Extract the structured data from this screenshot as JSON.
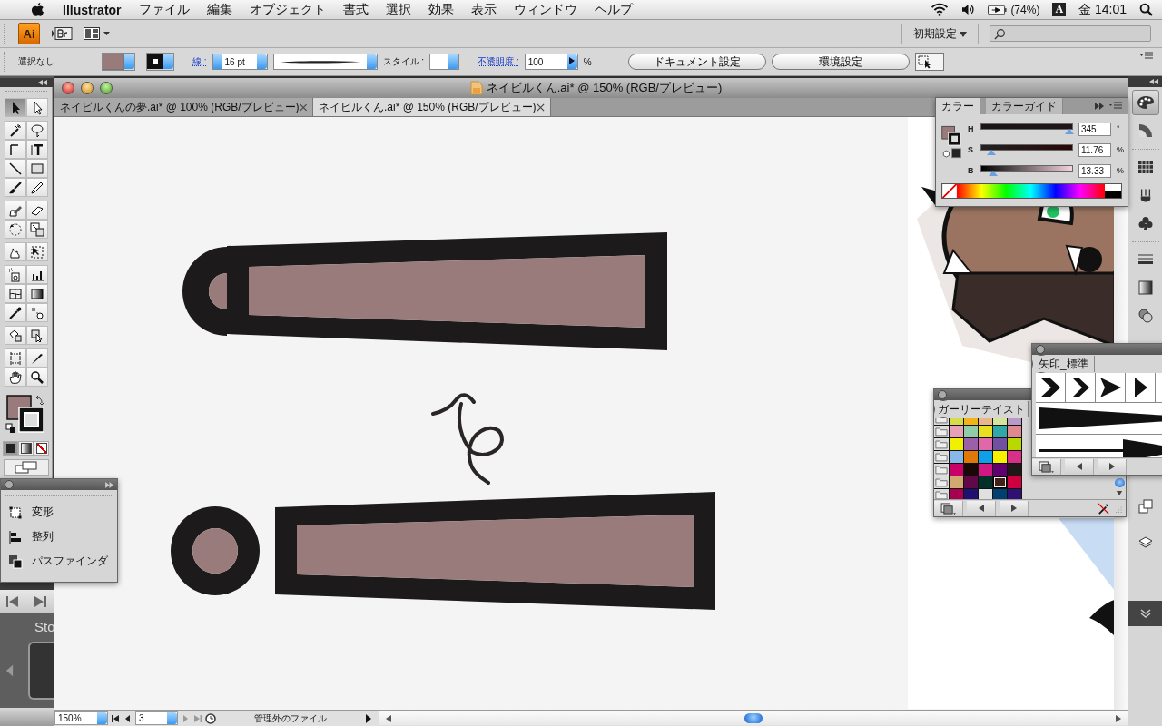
{
  "menu_bar": {
    "app_name": "Illustrator",
    "menus": [
      "ファイル",
      "編集",
      "オブジェクト",
      "書式",
      "選択",
      "効果",
      "表示",
      "ウィンドウ",
      "ヘルプ"
    ],
    "battery": "(74%)",
    "input_method": "A",
    "clock": "金 14:01"
  },
  "app_bar": {
    "logo": "Ai",
    "workspace": "初期設定"
  },
  "control_bar": {
    "selection": "選択なし",
    "stroke_label": "線 :",
    "stroke_weight": "16 pt",
    "style_label": "スタイル :",
    "opacity_label": "不透明度 :",
    "opacity": "100",
    "opacity_unit": "%",
    "buttons": [
      "ドキュメント設定",
      "環境設定"
    ]
  },
  "tools": [
    {
      "kind": "selection",
      "selected": true
    },
    {
      "kind": "direct-selection",
      "selected": false
    },
    {
      "kind": "magic-wand",
      "selected": false
    },
    {
      "kind": "lasso",
      "selected": false
    },
    {
      "kind": "pen",
      "selected": false
    },
    {
      "kind": "type",
      "selected": false
    },
    {
      "kind": "line",
      "selected": false
    },
    {
      "kind": "rectangle",
      "selected": false
    },
    {
      "kind": "paintbrush",
      "selected": false
    },
    {
      "kind": "pencil",
      "selected": false
    },
    {
      "kind": "blob-brush",
      "selected": false
    },
    {
      "kind": "eraser",
      "selected": false
    },
    {
      "kind": "rotate",
      "selected": false
    },
    {
      "kind": "scale",
      "selected": false
    },
    {
      "kind": "warp",
      "selected": false
    },
    {
      "kind": "free-transform",
      "selected": false
    },
    {
      "kind": "symbol-sprayer",
      "selected": false
    },
    {
      "kind": "graph",
      "selected": false
    },
    {
      "kind": "mesh",
      "selected": false
    },
    {
      "kind": "gradient",
      "selected": false
    },
    {
      "kind": "eyedropper",
      "selected": false
    },
    {
      "kind": "blend",
      "selected": false
    },
    {
      "kind": "live-paint",
      "selected": false
    },
    {
      "kind": "live-paint-select",
      "selected": false
    },
    {
      "kind": "artboard",
      "selected": false
    },
    {
      "kind": "slice",
      "selected": false
    },
    {
      "kind": "hand",
      "selected": false
    },
    {
      "kind": "zoom",
      "selected": false
    }
  ],
  "document": {
    "title": "ネイビルくん.ai* @ 150% (RGB/プレビュー)",
    "tabs": [
      {
        "label": "ネイビルくんの夢.ai* @ 100% (RGB/プレビュー)",
        "selected": false
      },
      {
        "label": "ネイビルくん.ai* @ 150% (RGB/プレビュー)",
        "selected": true
      }
    ]
  },
  "status_bar": {
    "zoom": "150%",
    "artboard": "3",
    "status": "管理外のファイル"
  },
  "color_panel": {
    "tabs": [
      {
        "label": "カラー",
        "selected": true
      },
      {
        "label": "カラーガイド",
        "selected": false
      }
    ],
    "channels": [
      {
        "label": "H",
        "level": 0.958,
        "reading": "345",
        "unit": "°"
      },
      {
        "label": "S",
        "level": 0.1176,
        "reading": "11.76",
        "unit": "%"
      },
      {
        "label": "B",
        "level": 0.1333,
        "reading": "13.33",
        "unit": "%"
      }
    ]
  },
  "transform_panel": {
    "items": [
      {
        "kind": "transform",
        "label": "変形"
      },
      {
        "kind": "align",
        "label": "整列"
      },
      {
        "kind": "pathfinder",
        "label": "パスファインダ"
      }
    ]
  },
  "swatches_panel": {
    "title": "ガーリーテイスト",
    "rows": [
      {
        "swatches": [
          {
            "color": "#d6dc4a",
            "selected": false
          },
          {
            "color": "#f0b41a",
            "selected": false
          },
          {
            "color": "#e8b888",
            "selected": false
          },
          {
            "color": "#d4e49a",
            "selected": false
          },
          {
            "color": "#b89ac8",
            "selected": false
          }
        ]
      },
      {
        "swatches": [
          {
            "color": "#e8a0b8",
            "selected": false
          },
          {
            "color": "#90ccaa",
            "selected": false
          },
          {
            "color": "#e8e020",
            "selected": false
          },
          {
            "color": "#30a8a8",
            "selected": false
          },
          {
            "color": "#e08890",
            "selected": false
          }
        ]
      },
      {
        "swatches": [
          {
            "color": "#f0f000",
            "selected": false
          },
          {
            "color": "#9a60a8",
            "selected": false
          },
          {
            "color": "#e068a8",
            "selected": false
          },
          {
            "color": "#7050a0",
            "selected": false
          },
          {
            "color": "#b8d800",
            "selected": false
          }
        ]
      },
      {
        "swatches": [
          {
            "color": "#88b8e8",
            "selected": false
          },
          {
            "color": "#e07808",
            "selected": false
          },
          {
            "color": "#10a0e8",
            "selected": false
          },
          {
            "color": "#f8f000",
            "selected": false
          },
          {
            "color": "#d83088",
            "selected": false
          }
        ]
      },
      {
        "swatches": [
          {
            "color": "#c80068",
            "selected": false
          },
          {
            "color": "#180808",
            "selected": false
          },
          {
            "color": "#d01880",
            "selected": false
          },
          {
            "color": "#600070",
            "selected": false
          },
          {
            "color": "#201818",
            "selected": false
          }
        ]
      },
      {
        "swatches": [
          {
            "color": "#d0a870",
            "selected": false
          },
          {
            "color": "#600848",
            "selected": false
          },
          {
            "color": "#003028",
            "selected": false
          },
          {
            "color": "#402018",
            "selected": true
          },
          {
            "color": "#d00040",
            "selected": false
          }
        ]
      },
      {
        "swatches": [
          {
            "color": "#a80050",
            "selected": false
          },
          {
            "color": "#201070",
            "selected": false
          },
          {
            "color": "#e0e0e0",
            "selected": false
          },
          {
            "color": "#004070",
            "selected": false
          },
          {
            "color": "#301070",
            "selected": false
          }
        ]
      }
    ]
  },
  "brushes_panel": {
    "title": "矢印_標準"
  },
  "background_app": {
    "label": "Sto"
  }
}
